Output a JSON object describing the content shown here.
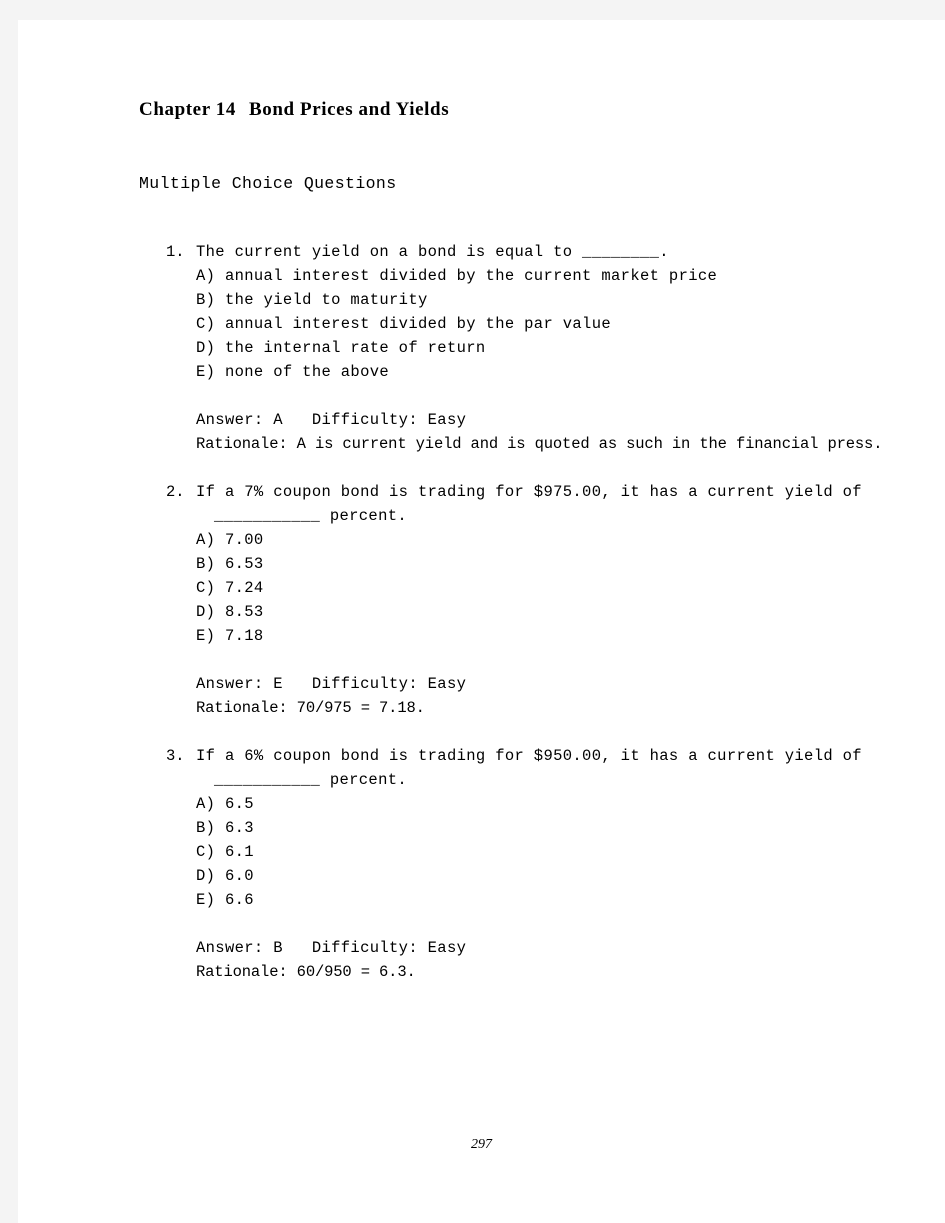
{
  "document": {
    "chapter_label": "Chapter 14",
    "chapter_title": "Bond Prices and Yields",
    "section_heading": "Multiple Choice Questions",
    "page_number": "297"
  },
  "questions": [
    {
      "number": "1.",
      "stem": "The current yield on a bond is equal to ________.",
      "stem_continuation": "",
      "options": [
        "A) annual interest divided by the current market price",
        "B) the yield to maturity",
        "C) annual interest divided by the par value",
        "D) the internal rate of return",
        "E) none of the above"
      ],
      "answer_line": "Answer: A   Difficulty: Easy",
      "rationale_line": "Rationale: A is current yield and is quoted as such in the financial press."
    },
    {
      "number": "2.",
      "stem": "If a 7% coupon bond is trading for $975.00, it has a current yield of",
      "stem_continuation": "___________ percent.",
      "options": [
        "A) 7.00",
        "B) 6.53",
        "C) 7.24",
        "D) 8.53",
        "E) 7.18"
      ],
      "answer_line": "Answer: E   Difficulty: Easy",
      "rationale_line": "Rationale: 70/975 = 7.18."
    },
    {
      "number": "3.",
      "stem": "If a 6% coupon bond is trading for $950.00, it has a current yield of",
      "stem_continuation": "___________ percent.",
      "options": [
        "A) 6.5",
        "B) 6.3",
        "C) 6.1",
        "D) 6.0",
        "E) 6.6"
      ],
      "answer_line": "Answer: B   Difficulty: Easy",
      "rationale_line": "Rationale: 60/950 = 6.3."
    }
  ]
}
